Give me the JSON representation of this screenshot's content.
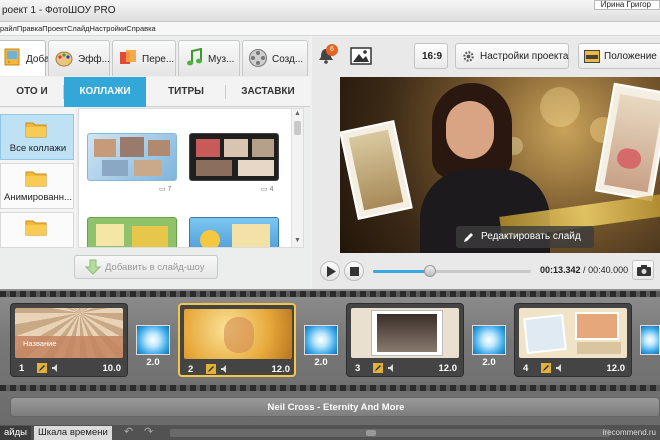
{
  "window": {
    "title": "роект 1 - ФотоШОУ PRO",
    "user": "Ирина Григор"
  },
  "menubar": {
    "items": [
      "райл",
      "Правка",
      "Проект",
      "Слайд",
      "Настройки",
      "Справка"
    ]
  },
  "left_tabs": [
    {
      "label": "Доба...",
      "icon": "add-photos-icon",
      "active": true
    },
    {
      "label": "Эфф...",
      "icon": "effects-palette-icon",
      "active": false
    },
    {
      "label": "Пере...",
      "icon": "transitions-icon",
      "active": false
    },
    {
      "label": "Муз...",
      "icon": "music-note-icon",
      "active": false
    },
    {
      "label": "Созд...",
      "icon": "film-reel-icon",
      "active": false
    }
  ],
  "sub_tabs": [
    {
      "label": "ОТО И ВИДЕО",
      "active": false
    },
    {
      "label": "КОЛЛАЖИ",
      "active": true
    },
    {
      "label": "ТИТРЫ",
      "active": false
    },
    {
      "label": "ЗАСТАВКИ",
      "active": false
    }
  ],
  "categories": [
    {
      "label": "Все коллажи",
      "active": true
    },
    {
      "label": "Анимированн...",
      "active": false
    },
    {
      "label": "",
      "active": false
    }
  ],
  "collages": [
    {
      "photos": "7"
    },
    {
      "photos": "4"
    },
    {
      "photos": ""
    },
    {
      "photos": ""
    }
  ],
  "add_button": {
    "label": "Добавить в слайд-шоу"
  },
  "toolbar": {
    "notification_count": "6",
    "aspect_label": "16:9",
    "project_settings_label": "Настройки проекта",
    "position_label": "Положение сл"
  },
  "preview": {
    "edit_label": "Редактировать слайд"
  },
  "playback": {
    "current_time": "00:13.342",
    "separator": " / ",
    "total_time": "00:40.000",
    "progress": 0.36
  },
  "slides": [
    {
      "number": "1",
      "duration": "10.0",
      "title": "Название",
      "active": false
    },
    {
      "number": "2",
      "duration": "12.0",
      "title": "",
      "active": true
    },
    {
      "number": "3",
      "duration": "12.0",
      "title": "",
      "active": false
    },
    {
      "number": "4",
      "duration": "12.0",
      "title": "",
      "active": false
    }
  ],
  "transitions": [
    {
      "duration": "2.0"
    },
    {
      "duration": "2.0"
    },
    {
      "duration": "2.0"
    },
    {
      "duration": ""
    }
  ],
  "music": {
    "track": "Neil Cross - Eternity And More"
  },
  "bottom_tabs": [
    {
      "label": "айды",
      "active": true
    },
    {
      "label": "Шкала времени",
      "active": false
    }
  ],
  "watermark": "irecommend.ru"
}
